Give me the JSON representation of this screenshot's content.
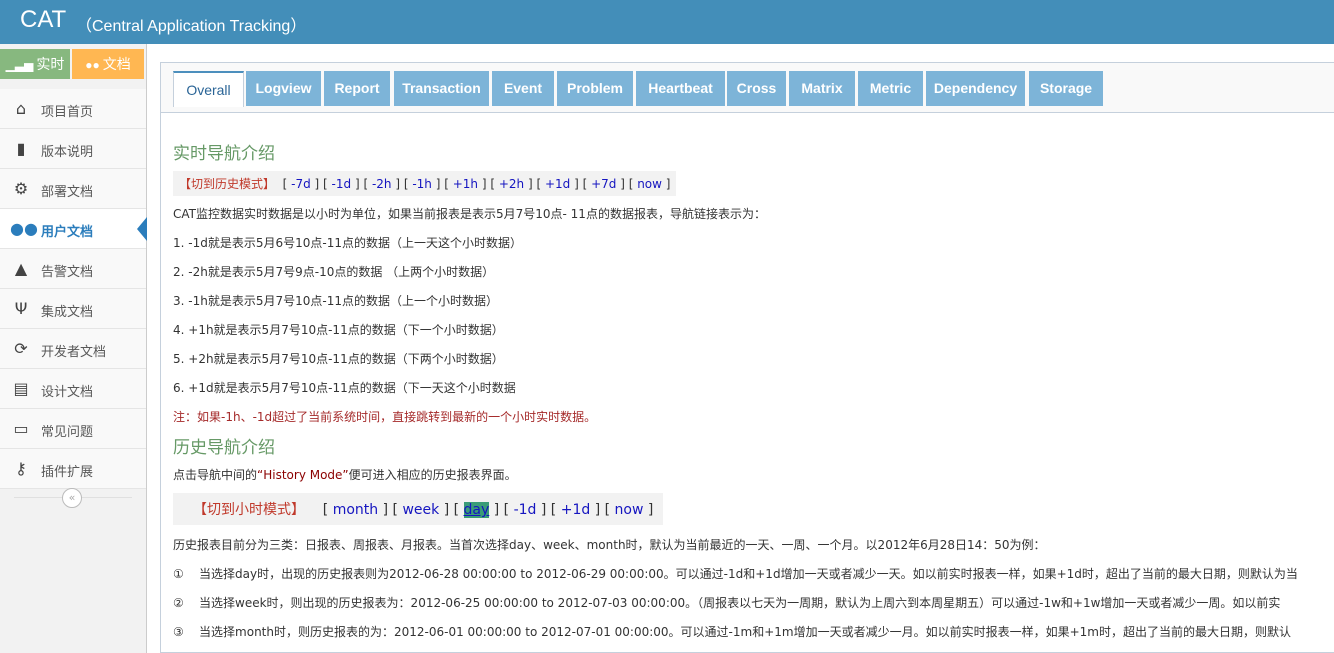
{
  "header": {
    "brand": "CAT",
    "subtitle": "（Central Application Tracking）"
  },
  "mode_buttons": {
    "realtime": "实时",
    "docs": "文档"
  },
  "sidebar": {
    "items": [
      {
        "label": "项目首页",
        "icon": "home-icon"
      },
      {
        "label": "版本说明",
        "icon": "book-icon"
      },
      {
        "label": "部署文档",
        "icon": "gears-icon"
      },
      {
        "label": "用户文档",
        "icon": "users-icon"
      },
      {
        "label": "告警文档",
        "icon": "bell-icon"
      },
      {
        "label": "集成文档",
        "icon": "cutlery-icon"
      },
      {
        "label": "开发者文档",
        "icon": "refresh-icon"
      },
      {
        "label": "设计文档",
        "icon": "notebook-icon"
      },
      {
        "label": "常见问题",
        "icon": "inbox-icon"
      },
      {
        "label": "插件扩展",
        "icon": "key-icon"
      }
    ],
    "collapse": "«"
  },
  "tabs": [
    "Overall",
    "Logview",
    "Report",
    "Transaction",
    "Event",
    "Problem",
    "Heartbeat",
    "Cross",
    "Matrix",
    "Metric",
    "Dependency",
    "Storage"
  ],
  "content": {
    "realtime_title": "实时导航介绍",
    "realtime_nav": {
      "mode": "【切到历史模式】",
      "links": [
        "-7d",
        "-1d",
        "-2h",
        "-1h",
        "+1h",
        "+2h",
        "+1d",
        "+7d",
        "now"
      ]
    },
    "intro": "CAT监控数据实时数据是以小时为单位，如果当前报表是表示5月7号10点- 11点的数据报表，导航链接表示为：",
    "lines": [
      "1. -1d就是表示5月6号10点-11点的数据（上一天这个小时数据）",
      "2. -2h就是表示5月7号9点-10点的数据 （上两个小时数据）",
      "3. -1h就是表示5月7号10点-11点的数据（上一个小时数据）",
      "4. +1h就是表示5月7号10点-11点的数据（下一个小时数据）",
      "5. +2h就是表示5月7号10点-11点的数据（下两个小时数据）",
      "6. +1d就是表示5月7号10点-11点的数据（下一天这个小时数据"
    ],
    "note": "注：如果-1h、-1d超过了当前系统时间，直接跳转到最新的一个小时实时数据。",
    "history_title": "历史导航介绍",
    "history_intro_pre": "点击导航中间的",
    "history_intro_mode": "“History Mode”",
    "history_intro_post": "便可进入相应的历史报表界面。",
    "history_nav": {
      "mode": "【切到小时模式】",
      "links": [
        "month",
        "week",
        "day",
        "-1d",
        "+1d",
        "now"
      ],
      "selected": "day"
    },
    "history_desc": "历史报表目前分为三类：日报表、周报表、月报表。当首次选择day、week、month时，默认为当前最近的一天、一周、一个月。以2012年6月28日14：50为例：",
    "history_items": [
      {
        "num": "①",
        "text": "当选择day时，出现的历史报表则为2012-06-28 00:00:00 to 2012-06-29 00:00:00。可以通过-1d和+1d增加一天或者减少一天。如以前实时报表一样，如果+1d时，超出了当前的最大日期，则默认为当"
      },
      {
        "num": "②",
        "text": "当选择week时，则出现的历史报表为：2012-06-25 00:00:00 to 2012-07-03 00:00:00。（周报表以七天为一周期，默认为上周六到本周星期五）可以通过-1w和+1w增加一天或者减少一周。如以前实"
      },
      {
        "num": "③",
        "text": "当选择month时，则历史报表的为：2012-06-01 00:00:00 to 2012-07-01 00:00:00。可以通过-1m和+1m增加一天或者减少一月。如以前实时报表一样，如果+1m时，超出了当前的最大日期，则默认"
      }
    ]
  }
}
